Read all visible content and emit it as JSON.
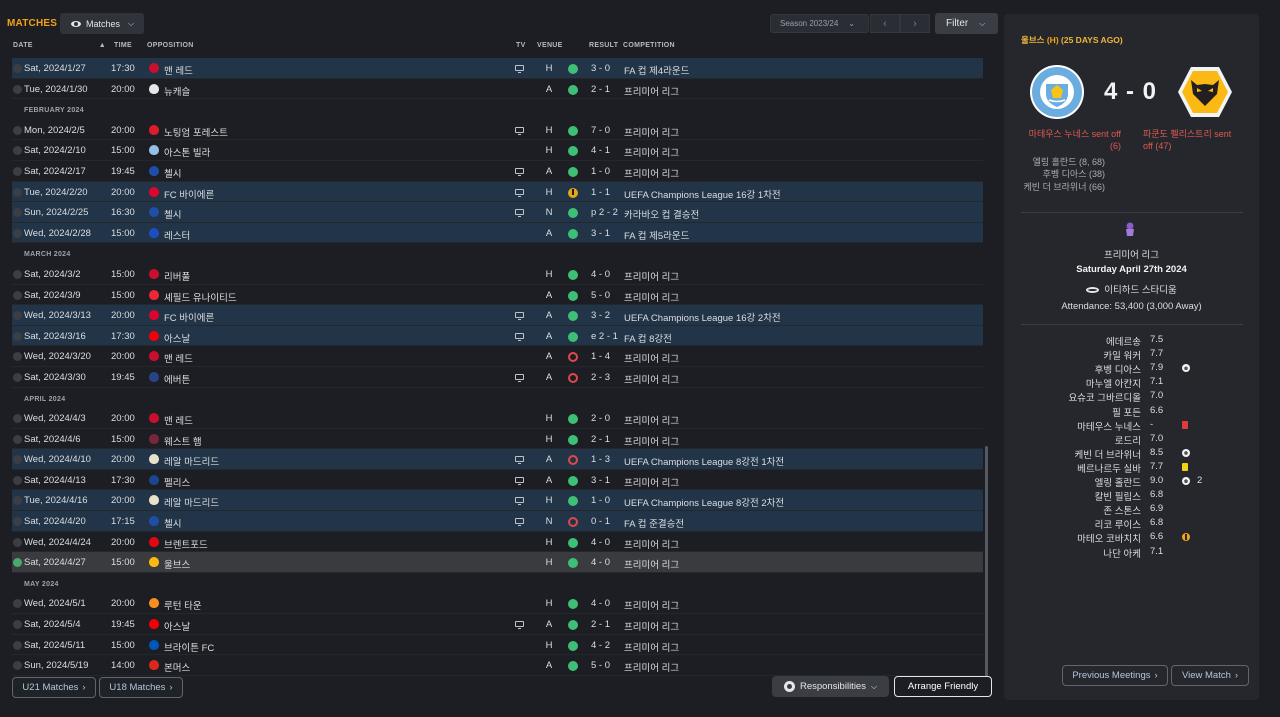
{
  "header": {
    "title": "MATCHES",
    "view_dropdown": "Matches",
    "season": "Season 2023/24",
    "filter": "Filter"
  },
  "columns": {
    "date": "DATE",
    "time": "TIME",
    "opposition": "OPPOSITION",
    "tv": "TV",
    "venue": "VENUE",
    "result": "RESULT",
    "competition": "COMPETITION"
  },
  "fixtures": [
    {
      "kind": "match",
      "date": "Sat, 2024/1/27",
      "time": "17:30",
      "opp": "맨 레드",
      "tv": true,
      "venue": "H",
      "res": "W",
      "score": "3 - 0",
      "comp": "FA 컵 제4라운드",
      "cup": true,
      "badge": "#c8102e"
    },
    {
      "kind": "match",
      "date": "Tue, 2024/1/30",
      "time": "20:00",
      "opp": "뉴캐슬",
      "tv": false,
      "venue": "A",
      "res": "W",
      "score": "2 - 1",
      "comp": "프리미어 리그",
      "badge": "#e6e6e6"
    },
    {
      "kind": "month",
      "label": "FEBRUARY 2024"
    },
    {
      "kind": "match",
      "date": "Mon, 2024/2/5",
      "time": "20:00",
      "opp": "노팅엄 포레스트",
      "tv": true,
      "venue": "H",
      "res": "W",
      "score": "7 - 0",
      "comp": "프리미어 리그",
      "badge": "#dd1c2a"
    },
    {
      "kind": "match",
      "date": "Sat, 2024/2/10",
      "time": "15:00",
      "opp": "아스톤 빌라",
      "tv": false,
      "venue": "H",
      "res": "W",
      "score": "4 - 1",
      "comp": "프리미어 리그",
      "badge": "#95bfe5"
    },
    {
      "kind": "match",
      "date": "Sat, 2024/2/17",
      "time": "19:45",
      "opp": "첼시",
      "tv": true,
      "venue": "A",
      "res": "W",
      "score": "1 - 0",
      "comp": "프리미어 리그",
      "badge": "#1f4ea8"
    },
    {
      "kind": "match",
      "date": "Tue, 2024/2/20",
      "time": "20:00",
      "opp": "FC 바이에른",
      "tv": true,
      "venue": "H",
      "res": "D",
      "score": "1 - 1",
      "comp": "UEFA Champions League 16강 1차전",
      "cup": true,
      "badge": "#dc052d"
    },
    {
      "kind": "match",
      "date": "Sun, 2024/2/25",
      "time": "16:30",
      "opp": "첼시",
      "tv": true,
      "venue": "N",
      "res": "W",
      "score": "p 2 - 2",
      "comp": "카라바오 컵 결승전",
      "cup": true,
      "badge": "#1f4ea8"
    },
    {
      "kind": "match",
      "date": "Wed, 2024/2/28",
      "time": "15:00",
      "opp": "레스터",
      "tv": false,
      "venue": "A",
      "res": "W",
      "score": "3 - 1",
      "comp": "FA 컵 제5라운드",
      "cup": true,
      "badge": "#1d4ec1"
    },
    {
      "kind": "month",
      "label": "MARCH 2024"
    },
    {
      "kind": "match",
      "date": "Sat, 2024/3/2",
      "time": "15:00",
      "opp": "리버풀",
      "tv": false,
      "venue": "H",
      "res": "W",
      "score": "4 - 0",
      "comp": "프리미어 리그",
      "badge": "#c8102e"
    },
    {
      "kind": "match",
      "date": "Sat, 2024/3/9",
      "time": "15:00",
      "opp": "셰필드 유나이티드",
      "tv": false,
      "venue": "A",
      "res": "W",
      "score": "5 - 0",
      "comp": "프리미어 리그",
      "badge": "#ee2737"
    },
    {
      "kind": "match",
      "date": "Wed, 2024/3/13",
      "time": "20:00",
      "opp": "FC 바이에른",
      "tv": true,
      "venue": "A",
      "res": "W",
      "score": "3 - 2",
      "comp": "UEFA Champions League 16강 2차전",
      "cup": true,
      "badge": "#dc052d"
    },
    {
      "kind": "match",
      "date": "Sat, 2024/3/16",
      "time": "17:30",
      "opp": "아스날",
      "tv": true,
      "venue": "A",
      "res": "W",
      "score": "e 2 - 1",
      "comp": "FA 컵 8강전",
      "cup": true,
      "badge": "#ef0107"
    },
    {
      "kind": "match",
      "date": "Wed, 2024/3/20",
      "time": "20:00",
      "opp": "맨 레드",
      "tv": false,
      "venue": "A",
      "res": "L",
      "score": "1 - 4",
      "comp": "프리미어 리그",
      "badge": "#c8102e"
    },
    {
      "kind": "match",
      "date": "Sat, 2024/3/30",
      "time": "19:45",
      "opp": "에버튼",
      "tv": true,
      "venue": "A",
      "res": "L",
      "score": "2 - 3",
      "comp": "프리미어 리그",
      "badge": "#274488"
    },
    {
      "kind": "month",
      "label": "APRIL 2024"
    },
    {
      "kind": "match",
      "date": "Wed, 2024/4/3",
      "time": "20:00",
      "opp": "맨 레드",
      "tv": false,
      "venue": "H",
      "res": "W",
      "score": "2 - 0",
      "comp": "프리미어 리그",
      "badge": "#c8102e"
    },
    {
      "kind": "match",
      "date": "Sat, 2024/4/6",
      "time": "15:00",
      "opp": "웨스트 햄",
      "tv": false,
      "venue": "H",
      "res": "W",
      "score": "2 - 1",
      "comp": "프리미어 리그",
      "badge": "#7a263a"
    },
    {
      "kind": "match",
      "date": "Wed, 2024/4/10",
      "time": "20:00",
      "opp": "레알 마드리드",
      "tv": true,
      "venue": "A",
      "res": "L",
      "score": "1 - 3",
      "comp": "UEFA Champions League 8강전 1차전",
      "cup": true,
      "badge": "#e8e2c8"
    },
    {
      "kind": "match",
      "date": "Sat, 2024/4/13",
      "time": "17:30",
      "opp": "펠리스",
      "tv": true,
      "venue": "A",
      "res": "W",
      "score": "3 - 1",
      "comp": "프리미어 리그",
      "badge": "#1b458f"
    },
    {
      "kind": "match",
      "date": "Tue, 2024/4/16",
      "time": "20:00",
      "opp": "레알 마드리드",
      "tv": true,
      "venue": "H",
      "res": "W",
      "score": "1 - 0",
      "comp": "UEFA Champions League 8강전 2차전",
      "cup": true,
      "badge": "#e8e2c8"
    },
    {
      "kind": "match",
      "date": "Sat, 2024/4/20",
      "time": "17:15",
      "opp": "첼시",
      "tv": true,
      "venue": "N",
      "res": "L",
      "score": "0 - 1",
      "comp": "FA 컵 준결승전",
      "cup": true,
      "badge": "#1f4ea8"
    },
    {
      "kind": "match",
      "date": "Wed, 2024/4/24",
      "time": "20:00",
      "opp": "브렌트포드",
      "tv": false,
      "venue": "H",
      "res": "W",
      "score": "4 - 0",
      "comp": "프리미어 리그",
      "badge": "#e30613"
    },
    {
      "kind": "match",
      "date": "Sat, 2024/4/27",
      "time": "15:00",
      "opp": "울브스",
      "tv": false,
      "venue": "H",
      "res": "W",
      "score": "4 - 0",
      "comp": "프리미어 리그",
      "selected": true,
      "badge": "#fdb913"
    },
    {
      "kind": "month",
      "label": "MAY 2024"
    },
    {
      "kind": "match",
      "date": "Wed, 2024/5/1",
      "time": "20:00",
      "opp": "루턴 타운",
      "tv": false,
      "venue": "H",
      "res": "W",
      "score": "4 - 0",
      "comp": "프리미어 리그",
      "badge": "#f78f1e"
    },
    {
      "kind": "match",
      "date": "Sat, 2024/5/4",
      "time": "19:45",
      "opp": "아스날",
      "tv": true,
      "venue": "A",
      "res": "W",
      "score": "2 - 1",
      "comp": "프리미어 리그",
      "badge": "#ef0107"
    },
    {
      "kind": "match",
      "date": "Sat, 2024/5/11",
      "time": "15:00",
      "opp": "브라이튼 FC",
      "tv": false,
      "venue": "H",
      "res": "W",
      "score": "4 - 2",
      "comp": "프리미어 리그",
      "badge": "#0057b8"
    },
    {
      "kind": "match",
      "date": "Sun, 2024/5/19",
      "time": "14:00",
      "opp": "본머스",
      "tv": false,
      "venue": "A",
      "res": "W",
      "score": "5 - 0",
      "comp": "프리미어 리그",
      "badge": "#da291c"
    }
  ],
  "bottom": {
    "u21": "U21 Matches",
    "u18": "U18 Matches",
    "responsibilities": "Responsibilities",
    "arrange": "Arrange Friendly"
  },
  "panel": {
    "opponent": "울브스",
    "venue_tag": "(H)",
    "ago": "(25 DAYS AGO)",
    "score": "4 - 0",
    "home_red": "마테우스 누네스 sent off (6)",
    "away_red": "파쿤도 펠리스트리 sent off (47)",
    "scorers": [
      "엘링 홀란드 (8, 68)",
      "후벵 디아스 (38)",
      "케빈 더 브라위너 (66)"
    ],
    "competition": "프리미어 리그",
    "date": "Saturday April 27th 2024",
    "stadium": "이티하드 스타디움",
    "attendance": "Attendance: 53,400 (3,000 Away)",
    "ratings": [
      {
        "name": "에데르송",
        "rating": "7.5",
        "ev": ""
      },
      {
        "name": "카일 워커",
        "rating": "7.7",
        "ev": ""
      },
      {
        "name": "후벵 디아스",
        "rating": "7.9",
        "ev": "ball"
      },
      {
        "name": "마누엘 아칸지",
        "rating": "7.1",
        "ev": ""
      },
      {
        "name": "요슈코 그바르디올",
        "rating": "7.0",
        "ev": ""
      },
      {
        "name": "필 포든",
        "rating": "6.6",
        "ev": ""
      },
      {
        "name": "마테우스 누네스",
        "rating": "-",
        "ev": "red"
      },
      {
        "name": "로드리",
        "rating": "7.0",
        "ev": ""
      },
      {
        "name": "케빈 더 브라위너",
        "rating": "8.5",
        "ev": "ball"
      },
      {
        "name": "베르나르두 실바",
        "rating": "7.7",
        "ev": "yel"
      },
      {
        "name": "엘링 홀란드",
        "rating": "9.0",
        "ev": "ball",
        "n": "2"
      },
      {
        "name": "칼빈 필립스",
        "rating": "6.8",
        "ev": ""
      },
      {
        "name": "존 스톤스",
        "rating": "6.9",
        "ev": ""
      },
      {
        "name": "리코 루이스",
        "rating": "6.8",
        "ev": ""
      },
      {
        "name": "마테오 코바치치",
        "rating": "6.6",
        "ev": "assist"
      },
      {
        "name": "나단 아케",
        "rating": "7.1",
        "ev": ""
      }
    ],
    "prev_meetings": "Previous Meetings",
    "view_match": "View Match",
    "colors": {
      "accent": "#f2a316",
      "red_card": "#df5a52",
      "win": "#3fbf76",
      "loss": "#e0484b",
      "draw": "#e3a718",
      "cup_row": "#223447"
    }
  }
}
